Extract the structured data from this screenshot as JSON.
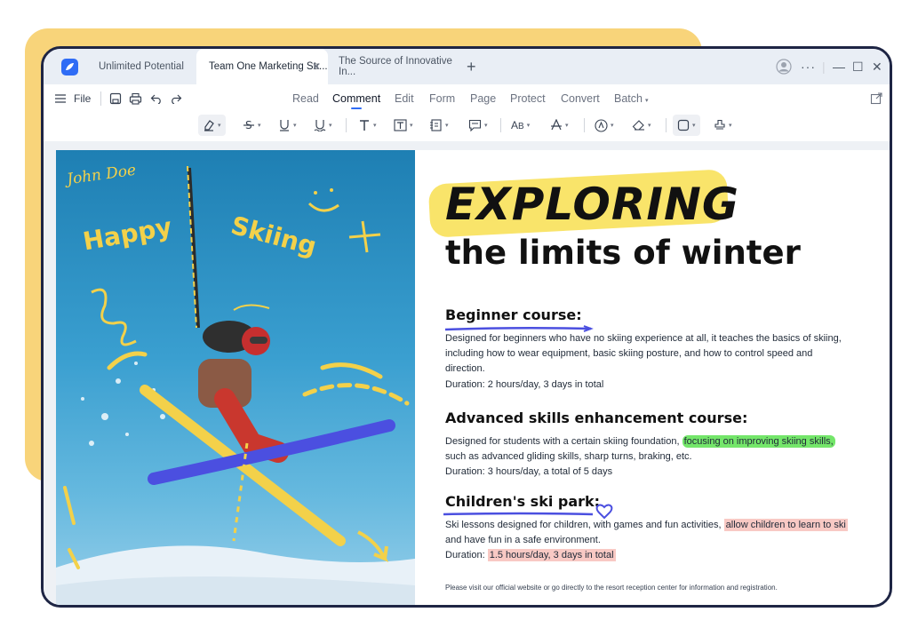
{
  "window": {
    "tabs": [
      {
        "label": "Unlimited Potential",
        "active": false
      },
      {
        "label": "Team One Marketing Str...",
        "active": true
      },
      {
        "label": "The Source of Innovative In...",
        "active": false
      }
    ],
    "new_tab": "+",
    "controls": [
      "—",
      "☐",
      "✕"
    ]
  },
  "toolbar": {
    "file_label": "File",
    "menus": [
      "Read",
      "Comment",
      "Edit",
      "Form",
      "Page",
      "Protect",
      "Convert",
      "Batch"
    ],
    "active_menu": "Comment"
  },
  "document": {
    "photo_annotations": {
      "name": "John Doe",
      "happy": "Happy",
      "skiing": "Skiing"
    },
    "title_line1": "EXPLORING",
    "title_line2": "the limits of winter",
    "sections": [
      {
        "heading": "Beginner course:",
        "lines": [
          "Designed for beginners who have no skiing experience at all, it teaches the basics of skiing,",
          "including how to wear equipment, basic skiing posture, and how to control speed and",
          "direction.",
          "Duration: 2 hours/day, 3 days in total"
        ]
      },
      {
        "heading": "Advanced skills enhancement course:",
        "line1_prefix": "Designed for students with a certain skiing foundation, ",
        "line1_highlight": "focusing on improving skiing skills,",
        "line2": "such as advanced gliding skills, sharp turns, braking, etc.",
        "line3": "Duration: 3 hours/day, a total of 5 days"
      },
      {
        "heading": "Children's ski park:",
        "line1_prefix": "Ski lessons designed for children, with games and fun activities, ",
        "line1_highlight": "allow children to learn to ski",
        "line2": "and have fun in a safe environment.",
        "line3_prefix": "Duration: ",
        "line3_highlight": "1.5 hours/day, 3 days in total"
      }
    ],
    "footer_note": "Please visit our official website or go directly to the resort reception center for information and registration."
  },
  "colors": {
    "accent": "#2f6cf5",
    "highlight_yellow": "#f9e46a",
    "highlight_green": "#74e66a",
    "highlight_pink": "#f8c9c4",
    "pen_blue": "#4b4fe0"
  }
}
